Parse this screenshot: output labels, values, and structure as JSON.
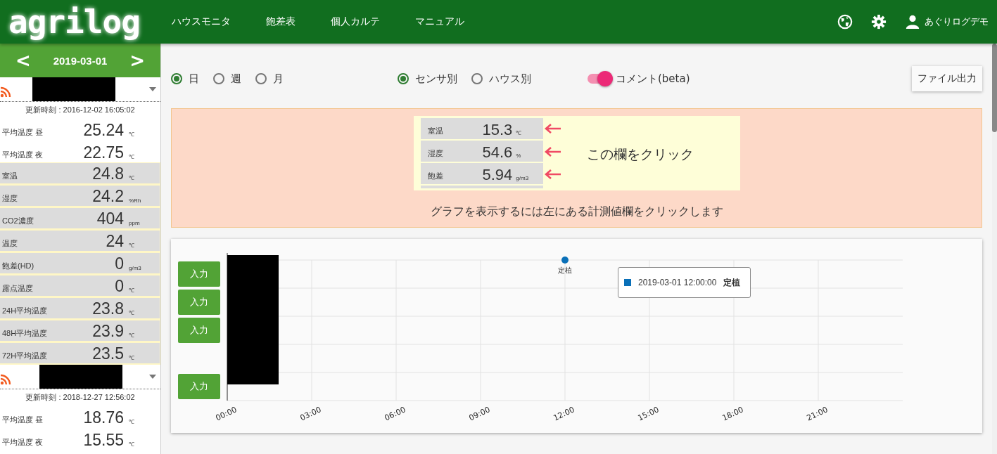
{
  "header": {
    "logo": "agrilog",
    "nav": [
      {
        "label": "ハウスモニタ"
      },
      {
        "label": "飽差表"
      },
      {
        "label": "個人カルテ"
      },
      {
        "label": "マニュアル"
      }
    ],
    "user": "あぐりログデモ"
  },
  "date_bar": {
    "prev": "<",
    "date": "2019-03-01",
    "next": ">"
  },
  "houses": [
    {
      "updated": "更新時刻 : 2016-12-02 16:05:02",
      "rows": [
        {
          "kind": "average",
          "label": "平均温度 昼",
          "value": "25.24",
          "unit": "℃"
        },
        {
          "kind": "average",
          "label": "平均温度 夜",
          "value": "22.75",
          "unit": "℃"
        },
        {
          "kind": "sensor",
          "label": "室温",
          "value": "24.8",
          "unit": "℃"
        },
        {
          "kind": "sensor",
          "label": "湿度",
          "value": "24.2",
          "unit": "%Rh"
        },
        {
          "kind": "sensor",
          "label": "CO2濃度",
          "value": "404",
          "unit": "ppm"
        },
        {
          "kind": "sensor",
          "label": "温度",
          "value": "24",
          "unit": "℃"
        },
        {
          "kind": "sensor",
          "label": "飽差(HD)",
          "value": "0",
          "unit": "g/m3"
        },
        {
          "kind": "sensor",
          "label": "露点温度",
          "value": "0",
          "unit": "℃"
        },
        {
          "kind": "sensor",
          "label": "24H平均温度",
          "value": "23.8",
          "unit": "℃"
        },
        {
          "kind": "sensor",
          "label": "48H平均温度",
          "value": "23.9",
          "unit": "℃"
        },
        {
          "kind": "sensor",
          "label": "72H平均温度",
          "value": "23.5",
          "unit": "℃"
        }
      ]
    },
    {
      "updated": "更新時刻 : 2018-12-27 12:56:02",
      "rows": [
        {
          "kind": "average",
          "label": "平均温度 昼",
          "value": "18.76",
          "unit": "℃"
        },
        {
          "kind": "average",
          "label": "平均温度 夜",
          "value": "15.55",
          "unit": "℃"
        }
      ]
    }
  ],
  "period": [
    {
      "label": "日",
      "selected": true
    },
    {
      "label": "週",
      "selected": false
    },
    {
      "label": "月",
      "selected": false
    }
  ],
  "grouping": [
    {
      "label": "センサ別",
      "selected": true
    },
    {
      "label": "ハウス別",
      "selected": false
    }
  ],
  "comment_toggle": {
    "label": "コメント(beta)",
    "on": true
  },
  "export_button": "ファイル出力",
  "help": {
    "rows": [
      {
        "label": "室温",
        "value": "15.3",
        "unit": "℃"
      },
      {
        "label": "湿度",
        "value": "54.6",
        "unit": "%"
      },
      {
        "label": "飽差",
        "value": "5.94",
        "unit": "g/m3"
      }
    ],
    "callout": "この欄をクリック",
    "hint": "グラフを表示するには左にある計測値欄をクリックします"
  },
  "chart": {
    "input_buttons": [
      "入力",
      "入力",
      "入力",
      "入力"
    ],
    "tooltip": {
      "time": "2019-03-01 12:00:00",
      "label": "定植"
    },
    "time_axis": [
      {
        "label": "00:00"
      },
      {
        "label": "03:00"
      },
      {
        "label": "06:00"
      },
      {
        "label": "09:00"
      },
      {
        "label": "12:00",
        "event": "定植"
      },
      {
        "label": "15:00"
      },
      {
        "label": "18:00"
      },
      {
        "label": "21:00"
      }
    ]
  }
}
